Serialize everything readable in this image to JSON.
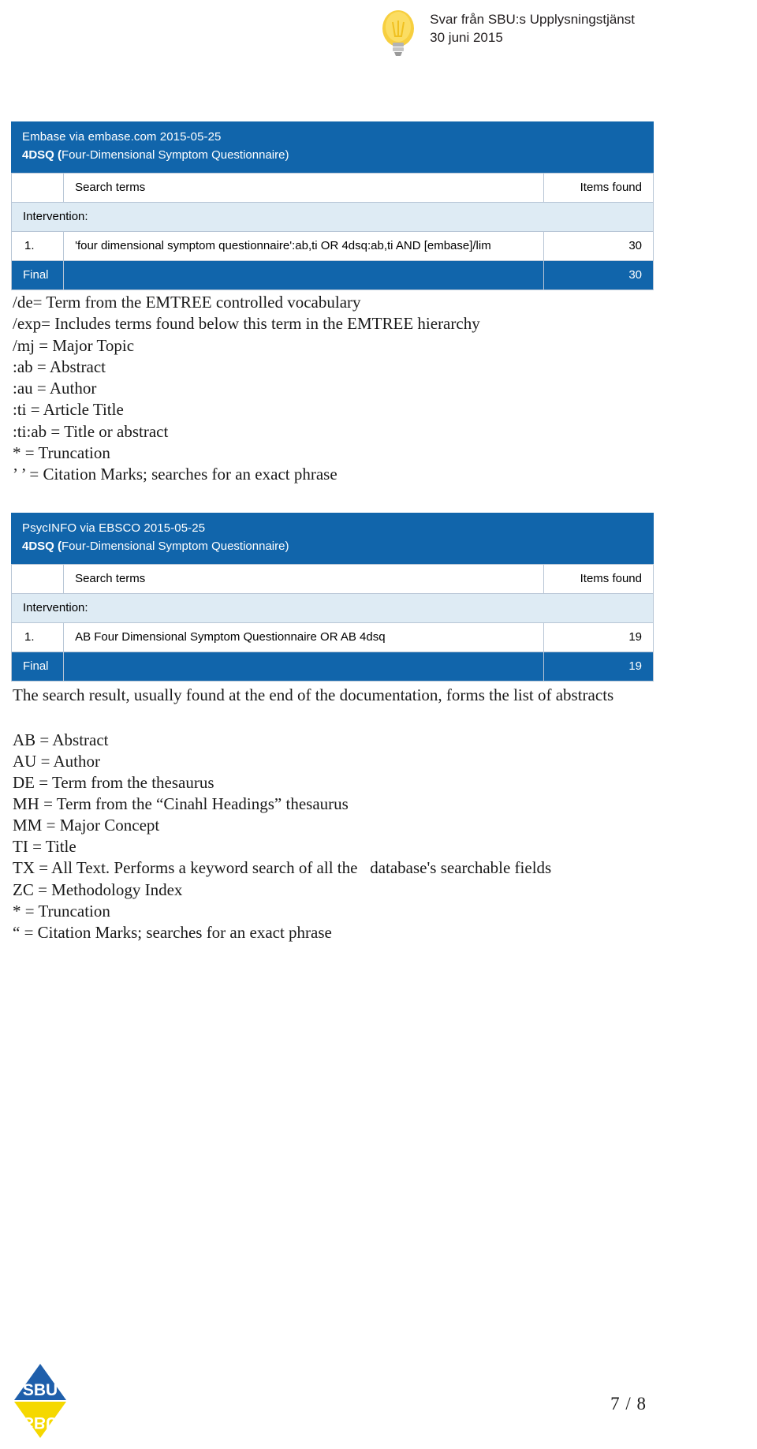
{
  "header": {
    "icon": "lightbulb-icon",
    "line1": "Svar från SBU:s Upplysningstjänst",
    "line2": "30 juni 2015"
  },
  "colors": {
    "accent_blue": "#1165ab",
    "group_row_blue": "#deebf4",
    "border": "#b8c6d6",
    "logo_blue": "#1f5fab",
    "logo_yellow": "#f5d800"
  },
  "sections": [
    {
      "database_line": "Embase via embase.com 2015-05-25",
      "topic_bold": "4DSQ (",
      "topic_rest": "Four-Dimensional Symptom Questionnaire)",
      "columns": {
        "number": "",
        "search_terms": "Search terms",
        "items_found": "Items found"
      },
      "group_label": "Intervention:",
      "rows": [
        {
          "number": "1.",
          "terms": "'four dimensional symptom questionnaire':ab,ti OR 4dsq:ab,ti AND [embase]/lim",
          "items": "30"
        }
      ],
      "final": {
        "label": "Final",
        "terms": "",
        "items": "30"
      },
      "legend": [
        "/de= Term from the EMTREE controlled vocabulary",
        "/exp= Includes terms found below this term in the EMTREE hierarchy",
        "/mj = Major Topic",
        ":ab = Abstract",
        ":au = Author",
        ":ti = Article Title",
        ":ti:ab = Title or abstract",
        "* = Truncation",
        "’ ’ = Citation Marks; searches for an exact phrase"
      ],
      "note": ""
    },
    {
      "database_line": "PsycINFO via EBSCO 2015-05-25",
      "topic_bold": "4DSQ (",
      "topic_rest": "Four-Dimensional Symptom Questionnaire)",
      "columns": {
        "number": "",
        "search_terms": "Search terms",
        "items_found": "Items found"
      },
      "group_label": "Intervention:",
      "rows": [
        {
          "number": "1.",
          "terms": "AB Four Dimensional Symptom Questionnaire OR AB 4dsq",
          "items": "19"
        }
      ],
      "final": {
        "label": "Final",
        "terms": "",
        "items": "19"
      },
      "note": "The search result, usually found at the end of the documentation, forms the list of abstracts",
      "legend": [
        "AB = Abstract",
        "AU = Author",
        "DE = Term from the thesaurus",
        "MH = Term from the “Cinahl Headings” thesaurus",
        "MM = Major Concept",
        "TI = Title",
        "TX = All Text. Performs a keyword search of all the   database's searchable fields",
        "ZC = Methodology Index",
        "* = Truncation",
        "“ = Citation Marks; searches for an exact phrase"
      ]
    }
  ],
  "footer": {
    "logo_text_top": "SBU",
    "logo_text_bottom": "SBU",
    "page_number": "7 / 8"
  }
}
